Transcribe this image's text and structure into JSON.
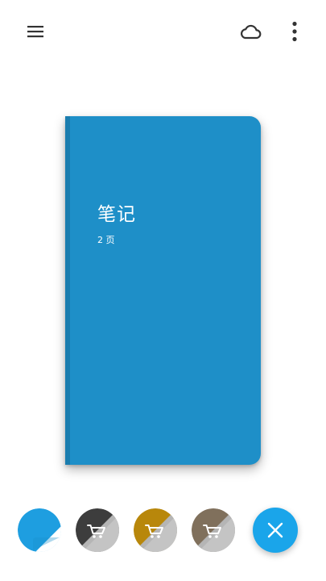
{
  "app": {
    "colors": {
      "background": "#ffffff",
      "icon": "#333333",
      "notebook_cover": "#1e8fc8",
      "fab": "#1aa5ea"
    }
  },
  "toolbar": {
    "menu_icon": "hamburger-menu-icon",
    "cloud_icon": "cloud-sync-icon",
    "more_icon": "more-vertical-icon"
  },
  "notebook": {
    "title": "笔记",
    "pages": "2 页"
  },
  "themes": [
    {
      "name": "blue",
      "color": "#1e9ee0",
      "icon": "page-fold-icon",
      "selected": true
    },
    {
      "name": "dark-gray",
      "color": "#3d3d3d",
      "icon": "shopping-cart-icon"
    },
    {
      "name": "golden",
      "color": "#b8870b",
      "icon": "shopping-cart-icon"
    },
    {
      "name": "brown",
      "color": "#80705c",
      "icon": "shopping-cart-icon"
    }
  ],
  "fab": {
    "icon": "close-icon"
  }
}
